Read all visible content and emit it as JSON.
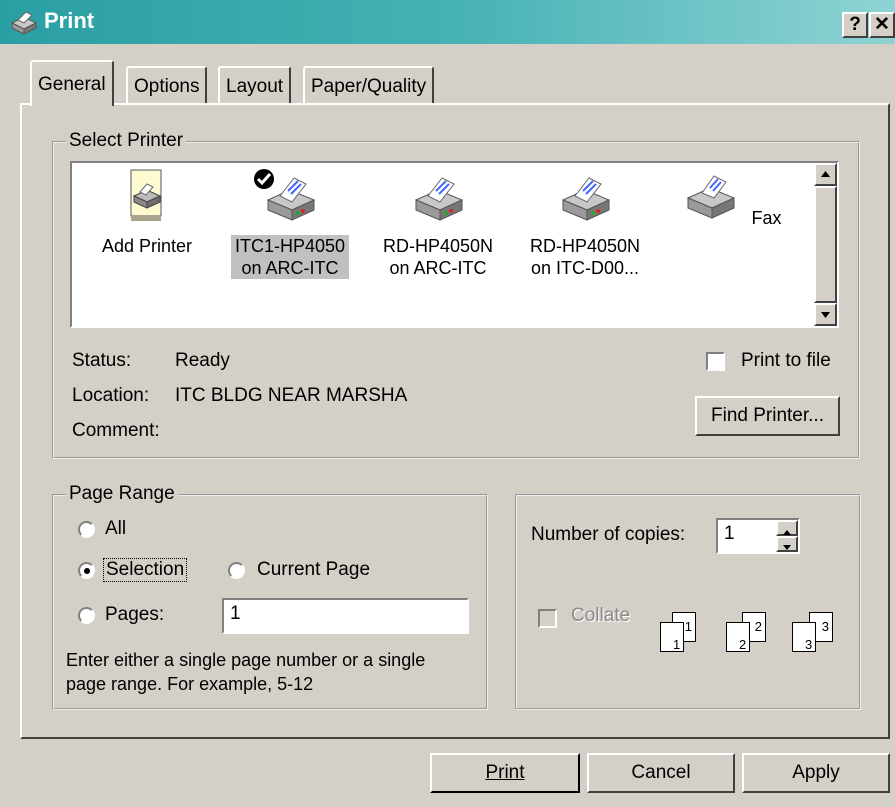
{
  "window": {
    "title": "Print",
    "help_glyph": "?",
    "close_glyph": "✕"
  },
  "tabs": [
    {
      "label": "General",
      "active": true
    },
    {
      "label": "Options"
    },
    {
      "label": "Layout"
    },
    {
      "label": "Paper/Quality"
    }
  ],
  "select_printer": {
    "legend": "Select Printer",
    "printers": [
      {
        "line1": "Add Printer",
        "line2": ""
      },
      {
        "line1": "ITC1-HP4050",
        "line2": "on ARC-ITC",
        "selected": true,
        "default": true
      },
      {
        "line1": "RD-HP4050N",
        "line2": "on ARC-ITC"
      },
      {
        "line1": "RD-HP4050N",
        "line2": "on ITC-D00..."
      },
      {
        "line1": "Fax",
        "line2": ""
      }
    ],
    "status_label": "Status:",
    "status_value": "Ready",
    "location_label": "Location:",
    "location_value": "ITC BLDG NEAR MARSHA",
    "comment_label": "Comment:",
    "print_to_file_label": "Print to file",
    "find_printer_label": "Find Printer..."
  },
  "page_range": {
    "legend": "Page Range",
    "all_label": "All",
    "selection_label": "Selection",
    "current_page_label": "Current Page",
    "pages_label": "Pages:",
    "pages_value": "1",
    "selected": "selection",
    "help_line1": "Enter either a single page number or a single",
    "help_line2": "page range.  For example, 5-12"
  },
  "copies": {
    "label": "Number of copies:",
    "value": "1",
    "collate_label": "Collate",
    "collate_enabled": false,
    "collate_pages": [
      "1",
      "1",
      "2",
      "2",
      "3",
      "3"
    ]
  },
  "footer": {
    "print_label": "Print",
    "cancel_label": "Cancel",
    "apply_label": "Apply"
  },
  "colors": {
    "title_start": "#2a9fa3",
    "title_end": "#8fd3d4",
    "face": "#d4d0c8"
  },
  "icons": [
    "printer-icon",
    "add-printer-icon",
    "default-check-icon",
    "fax-icon",
    "scroll-up-icon",
    "scroll-down-icon",
    "spin-up-icon",
    "spin-down-icon"
  ]
}
